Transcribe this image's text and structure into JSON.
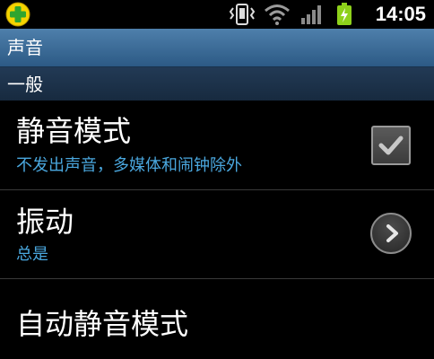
{
  "status_bar": {
    "app_icon": "plus-shield-app-icon",
    "icons": [
      "vibrate-icon",
      "wifi-icon",
      "signal-icon",
      "battery-charging-icon"
    ],
    "time": "14:05"
  },
  "title_bar": {
    "title": "声音"
  },
  "section": {
    "header": "一般"
  },
  "settings": [
    {
      "title": "静音模式",
      "summary": "不发出声音，多媒体和闹钟除外",
      "control": "checkbox",
      "checked": true
    },
    {
      "title": "振动",
      "summary": "总是",
      "control": "chevron-button"
    },
    {
      "title": "自动静音模式"
    }
  ],
  "colors": {
    "accent_text": "#4aa7de",
    "title_bar": "#3a6b98",
    "section_header": "#1d3149",
    "battery": "#8ed11b"
  }
}
